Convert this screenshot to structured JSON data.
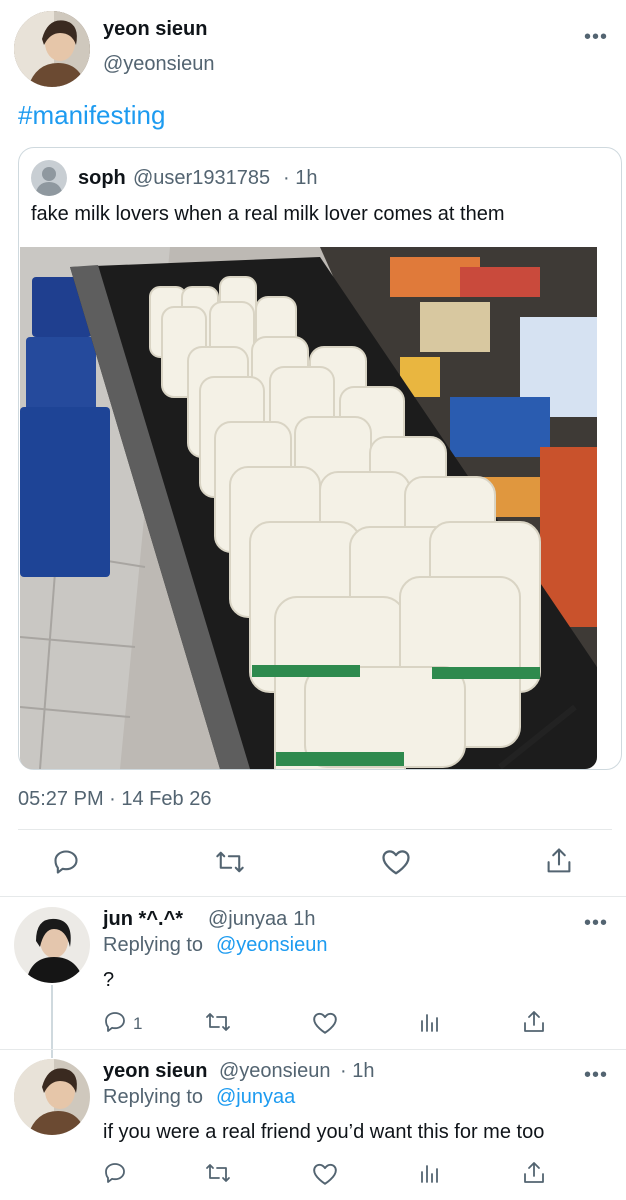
{
  "main_tweet": {
    "display_name": "yeon sieun",
    "handle": "@yeonsieun",
    "text": "#manifesting",
    "timestamp": "05:27 PM · 14 Feb 26",
    "quoted": {
      "display_name": "soph",
      "handle": "@user1931785",
      "time": "· 1h",
      "text": "fake milk lovers when a real milk lover comes at them"
    }
  },
  "replies": [
    {
      "display_name": "jun *^.^*",
      "handle": "@junyaa",
      "time": "· 1h",
      "replying_label": "Replying to",
      "replying_to": "@yeonsieun",
      "text": "?",
      "reply_count": "1"
    },
    {
      "display_name": "yeon sieun",
      "handle": "@yeonsieun",
      "time": "· 1h",
      "replying_label": "Replying to",
      "replying_to": "@junyaa",
      "text": "if you were a real friend you’d want this for me too"
    }
  ],
  "more_glyph": "•••",
  "colors": {
    "link": "#1d9bf0",
    "secondary": "#536471",
    "divider": "#e6e9ea"
  }
}
